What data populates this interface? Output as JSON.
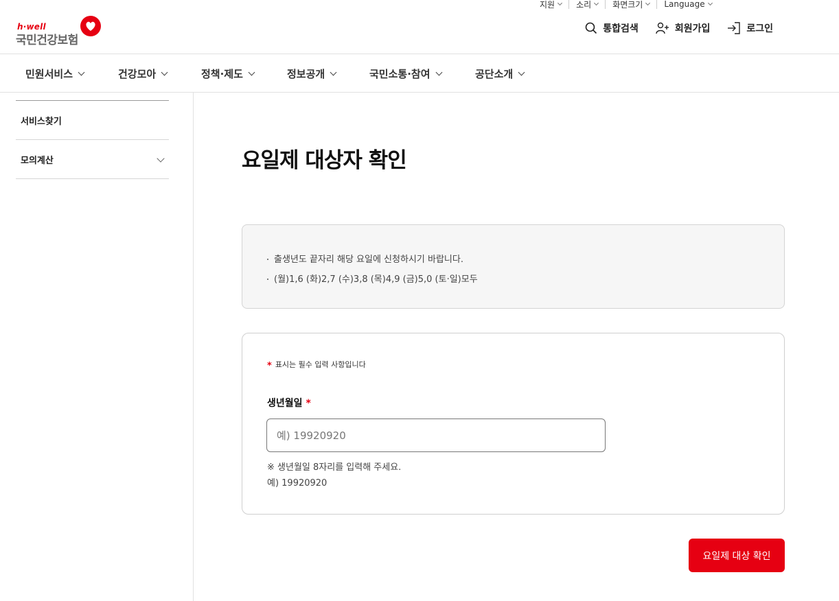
{
  "utility": {
    "items": [
      "지원",
      "소리",
      "화면크기",
      "Language"
    ]
  },
  "logo": {
    "tagline": "h·well",
    "name": "국민건강보험"
  },
  "actions": {
    "search": "통합검색",
    "join": "회원가입",
    "login": "로그인"
  },
  "gnb": {
    "items": [
      "민원서비스",
      "건강모아",
      "정책·제도",
      "정보공개",
      "국민소통·참여",
      "공단소개"
    ]
  },
  "sidebar": {
    "items": [
      {
        "label": "서비스찾기"
      },
      {
        "label": "모의계산"
      }
    ]
  },
  "page": {
    "title": "요일제 대상자 확인"
  },
  "notice": {
    "lines": [
      "출생년도 끝자리 해당 요일에 신청하시기 바랍니다.",
      "(월)1,6 (화)2,7 (수)3,8 (목)4,9 (금)5,0 (토·일)모두"
    ]
  },
  "form": {
    "required_star": "*",
    "required_note": "표시는 필수 입력 사항입니다",
    "birth_label": "생년월일",
    "birth_value": "",
    "birth_placeholder": "예) 19920920",
    "help_line1": "※ 생년월일 8자리를 입력해 주세요.",
    "help_line2": "예) 19920920"
  },
  "submit": {
    "label": "요일제 대상 확인"
  },
  "colors": {
    "brand": "#e60012",
    "border": "#e1e1e1",
    "notice_bg": "#f6f6f6"
  }
}
